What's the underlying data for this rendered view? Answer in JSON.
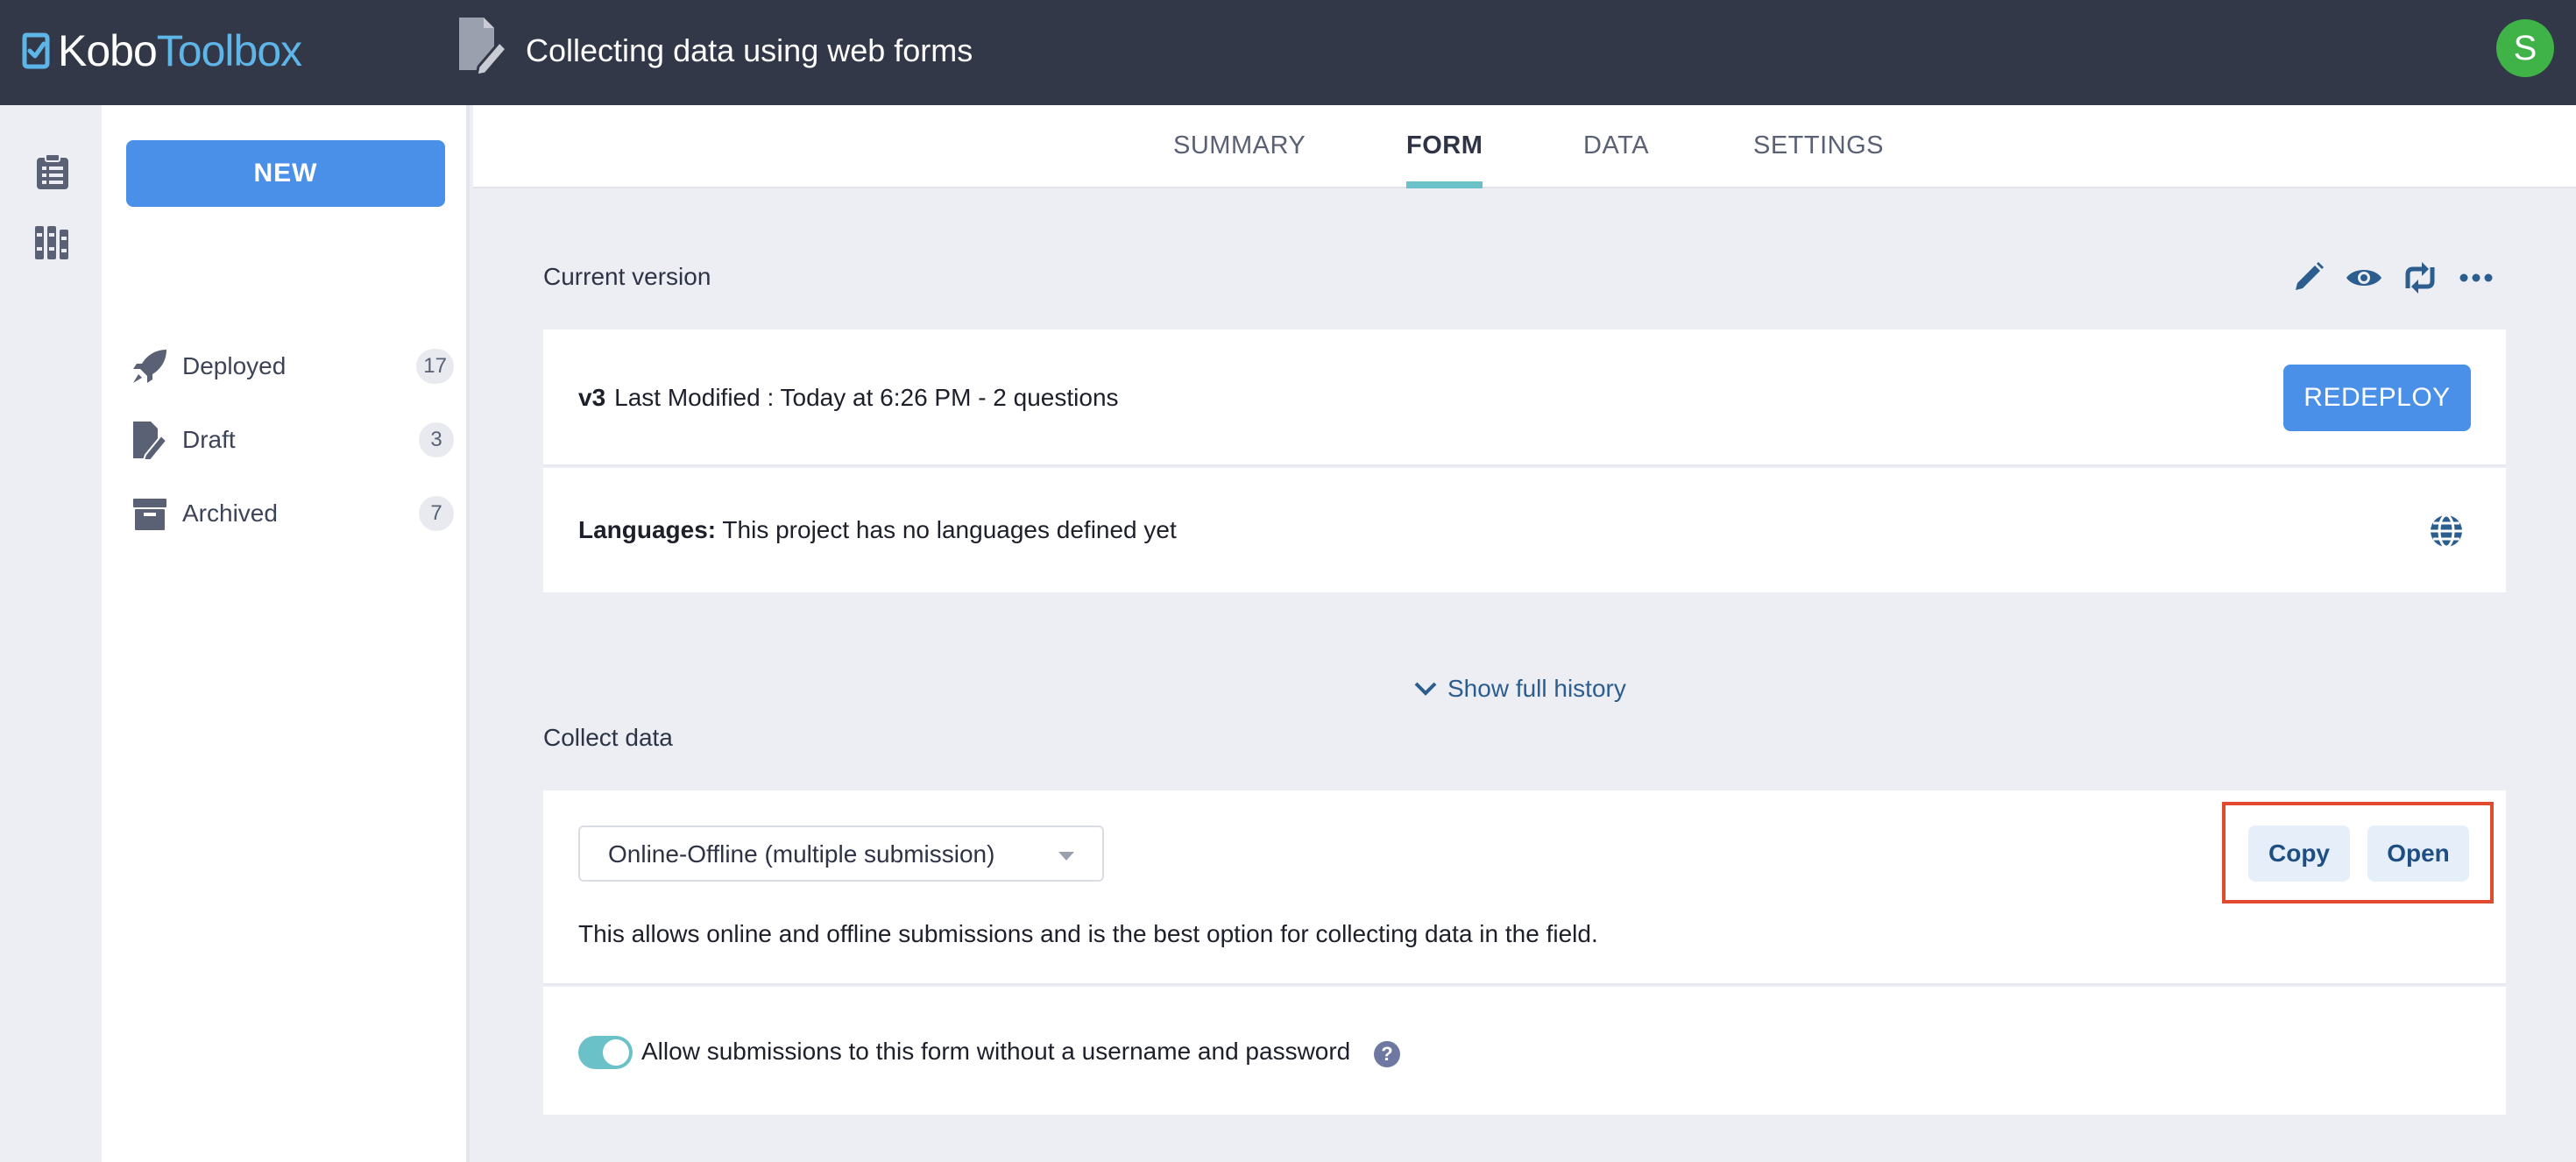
{
  "header": {
    "logo_kobo": "Kobo",
    "logo_toolbox": "Toolbox",
    "project_title": "Collecting data using web forms",
    "avatar_initial": "S",
    "avatar_color": "#3fb348"
  },
  "rail": {
    "icons": [
      "clipboard-list-icon",
      "library-books-icon"
    ]
  },
  "sidebar": {
    "new_label": "NEW",
    "items": [
      {
        "label": "Deployed",
        "count": "17",
        "icon": "rocket-icon"
      },
      {
        "label": "Draft",
        "count": "3",
        "icon": "draft-edit-icon"
      },
      {
        "label": "Archived",
        "count": "7",
        "icon": "archive-box-icon"
      }
    ]
  },
  "tabs": [
    {
      "label": "SUMMARY",
      "active": false
    },
    {
      "label": "FORM",
      "active": true
    },
    {
      "label": "DATA",
      "active": false
    },
    {
      "label": "SETTINGS",
      "active": false
    }
  ],
  "current_version": {
    "title": "Current version",
    "toolbar_icons": [
      "edit-pencil-icon",
      "preview-eye-icon",
      "replace-sync-icon",
      "more-dots-icon"
    ],
    "version": "v3",
    "details": "Last Modified : Today at 6:26 PM - 2 questions",
    "redeploy_label": "REDEPLOY",
    "languages_label": "Languages:",
    "languages_value": "This project has no languages defined yet"
  },
  "history": {
    "label": "Show full history"
  },
  "collect_data": {
    "title": "Collect data",
    "select_value": "Online-Offline (multiple submission)",
    "description": "This allows online and offline submissions and is the best option for collecting data in the field.",
    "copy_label": "Copy",
    "open_label": "Open",
    "toggle_on": true,
    "toggle_label": "Allow submissions to this form without a username and password",
    "help_glyph": "?"
  },
  "colors": {
    "primary": "#4a90e8",
    "header_bg": "#333849",
    "tab_accent": "#6ac1c8",
    "highlight": "#e04a2f"
  }
}
